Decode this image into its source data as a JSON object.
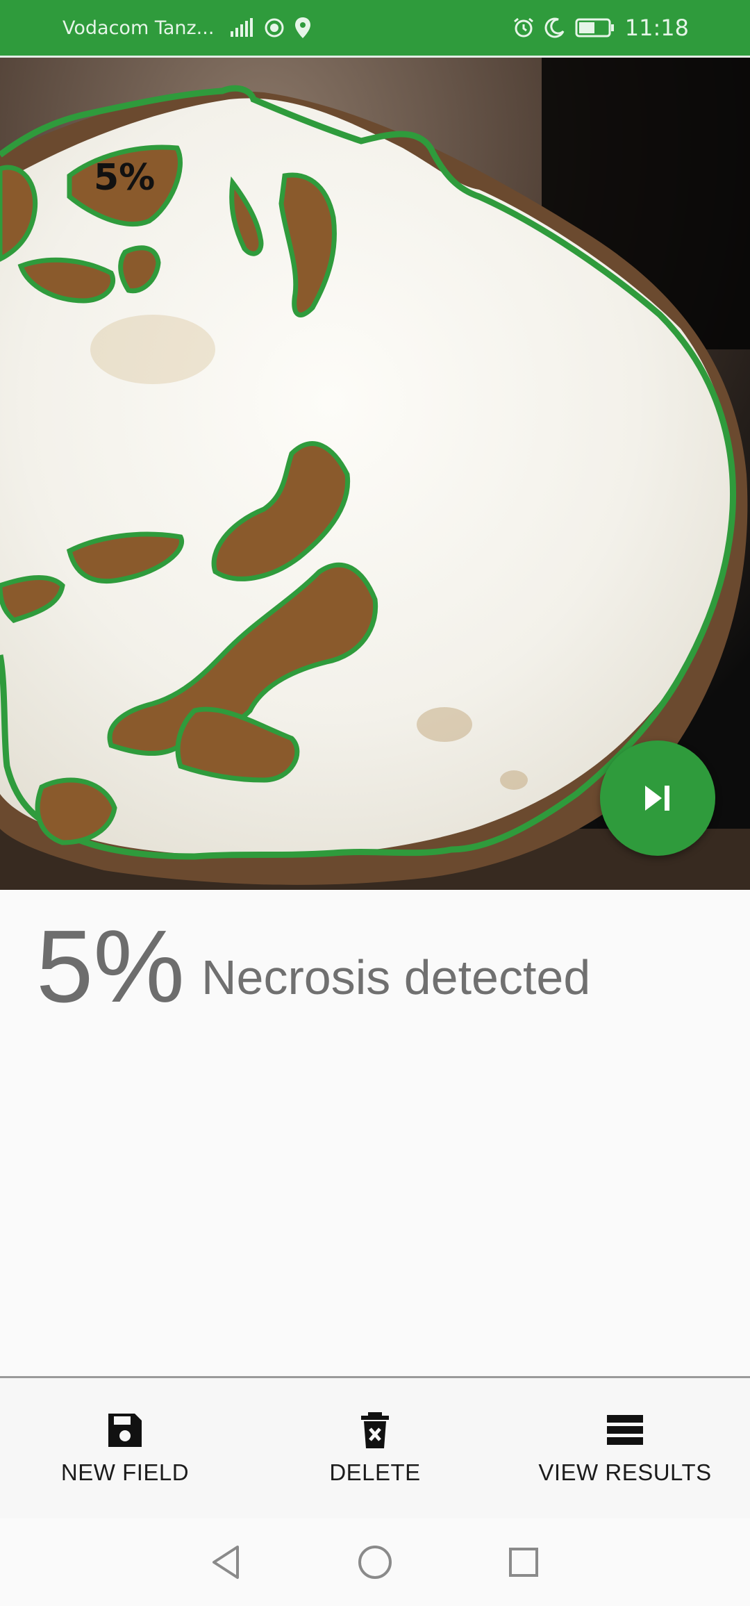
{
  "status_bar": {
    "carrier": "Vodacom Tanz...",
    "time": "11:18",
    "left_icons": [
      "signal-icon",
      "data-saver-icon",
      "location-icon"
    ],
    "right_icons": [
      "alarm-icon",
      "moon-icon",
      "battery-icon"
    ]
  },
  "photo": {
    "overlay_label": "5%",
    "outline_color": "#2f9b3c"
  },
  "fab": {
    "icon": "skip-next-icon",
    "color": "#2f9b3c"
  },
  "result": {
    "percent": "5%",
    "label": "Necrosis detected"
  },
  "bottom_nav": {
    "items": [
      {
        "label": "NEW FIELD",
        "icon": "save-icon"
      },
      {
        "label": "DELETE",
        "icon": "trash-icon"
      },
      {
        "label": "VIEW RESULTS",
        "icon": "list-icon"
      }
    ]
  },
  "system_nav": {
    "buttons": [
      "back-icon",
      "home-icon",
      "recents-icon"
    ]
  }
}
